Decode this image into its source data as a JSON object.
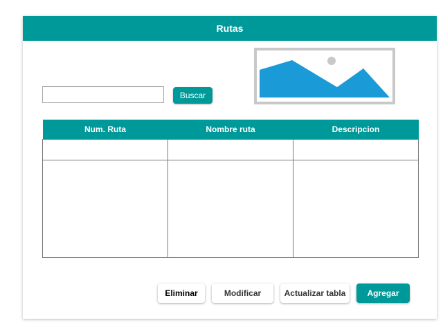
{
  "header": {
    "title": "Rutas"
  },
  "search": {
    "value": "",
    "button_label": "Buscar"
  },
  "table": {
    "columns": [
      "Num. Ruta",
      "Nombre ruta",
      "Descripcion"
    ],
    "rows": [
      [
        "",
        "",
        ""
      ],
      [
        "",
        "",
        ""
      ]
    ]
  },
  "actions": {
    "eliminar": "Eliminar",
    "modificar": "Modificar",
    "actualizar": "Actualizar tabla",
    "agregar": "Agregar"
  },
  "colors": {
    "accent": "#009999",
    "image_fill": "#1a9bd7"
  }
}
